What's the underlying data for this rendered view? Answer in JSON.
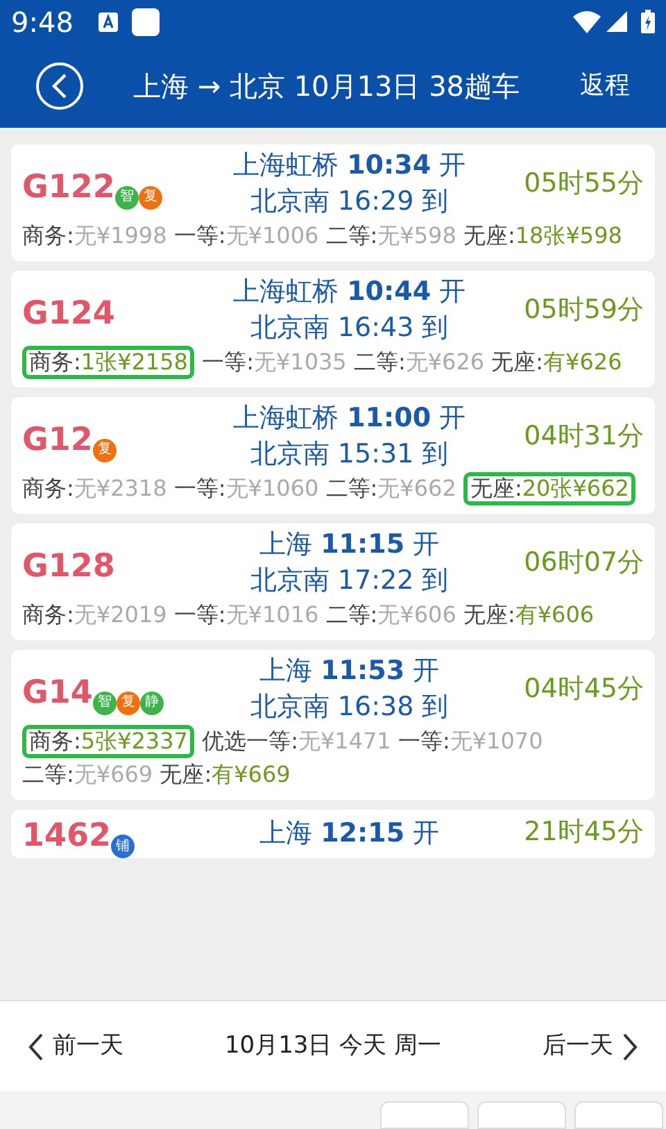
{
  "status_bar": {
    "time": "9:48"
  },
  "header": {
    "title": "上海 → 北京 10月13日 38趟车",
    "return_button": "返程"
  },
  "trains": [
    {
      "code": "G122",
      "badges": [
        {
          "text": "智",
          "color": "#3cb44a"
        },
        {
          "text": "复",
          "color": "#f07010"
        }
      ],
      "departure": {
        "station": "上海虹桥",
        "time": "10:34",
        "word": "开"
      },
      "arrival": "北京南 16:29 到",
      "duration": "05时55分",
      "seats": [
        {
          "label": "商务:",
          "value": "无¥1998",
          "available": false,
          "highlighted": false
        },
        {
          "label": "一等:",
          "value": "无¥1006",
          "available": false,
          "highlighted": false
        },
        {
          "label": "二等:",
          "value": "无¥598",
          "available": false,
          "highlighted": false
        },
        {
          "label": "无座:",
          "value": "18张¥598",
          "available": true,
          "highlighted": false
        }
      ]
    },
    {
      "code": "G124",
      "departure": {
        "station": "上海虹桥",
        "time": "10:44",
        "word": "开"
      },
      "arrival": "北京南 16:43 到",
      "duration": "05时59分",
      "seats": [
        {
          "label": "商务:",
          "value": "1张¥2158",
          "available": true,
          "highlighted": true
        },
        {
          "label": "一等:",
          "value": "无¥1035",
          "available": false,
          "highlighted": false
        },
        {
          "label": "二等:",
          "value": "无¥626",
          "available": false,
          "highlighted": false
        },
        {
          "label": "无座:",
          "value": "有¥626",
          "available": true,
          "highlighted": false
        }
      ]
    },
    {
      "code": "G12",
      "badges": [
        {
          "text": "复",
          "color": "#f07010"
        }
      ],
      "departure": {
        "station": "上海虹桥",
        "time": "11:00",
        "word": "开"
      },
      "arrival": "北京南 15:31 到",
      "duration": "04时31分",
      "seats": [
        {
          "label": "商务:",
          "value": "无¥2318",
          "available": false,
          "highlighted": false
        },
        {
          "label": "一等:",
          "value": "无¥1060",
          "available": false,
          "highlighted": false
        },
        {
          "label": "二等:",
          "value": "无¥662",
          "available": false,
          "highlighted": false
        },
        {
          "label": "无座:",
          "value": "20张¥662",
          "available": true,
          "highlighted": true
        }
      ]
    },
    {
      "code": "G128",
      "departure": {
        "station": "上海",
        "time": "11:15",
        "word": "开"
      },
      "arrival": "北京南 17:22 到",
      "duration": "06时07分",
      "seats": [
        {
          "label": "商务:",
          "value": "无¥2019",
          "available": false,
          "highlighted": false
        },
        {
          "label": "一等:",
          "value": "无¥1016",
          "available": false,
          "highlighted": false
        },
        {
          "label": "二等:",
          "value": "无¥606",
          "available": false,
          "highlighted": false
        },
        {
          "label": "无座:",
          "value": "有¥606",
          "available": true,
          "highlighted": false
        }
      ]
    },
    {
      "code": "G14",
      "badges": [
        {
          "text": "智",
          "color": "#3cb44a"
        },
        {
          "text": "复",
          "color": "#f07010"
        },
        {
          "text": "静",
          "color": "#3cb44a"
        }
      ],
      "departure": {
        "station": "上海",
        "time": "11:53",
        "word": "开"
      },
      "arrival": "北京南 16:38 到",
      "duration": "04时45分",
      "seats": [
        {
          "label": "商务:",
          "value": "5张¥2337",
          "available": true,
          "highlighted": true
        },
        {
          "label": "优选一等:",
          "value": "无¥1471",
          "available": false,
          "highlighted": false
        },
        {
          "label": "一等:",
          "value": "无¥1070",
          "available": false,
          "highlighted": false
        },
        {
          "label": "二等:",
          "value": "无¥669",
          "available": false,
          "highlighted": false
        },
        {
          "label": "无座:",
          "value": "有¥669",
          "available": true,
          "highlighted": false
        }
      ]
    },
    {
      "code": "1462",
      "badges": [
        {
          "text": "铺",
          "color": "#2a6fd0"
        }
      ],
      "departure": {
        "station": "上海",
        "time": "12:15",
        "word": "开"
      },
      "duration": "21时45分"
    }
  ],
  "date_bar": {
    "previous": "前一天",
    "current": "10月13日 今天 周一",
    "next": "后一天"
  }
}
